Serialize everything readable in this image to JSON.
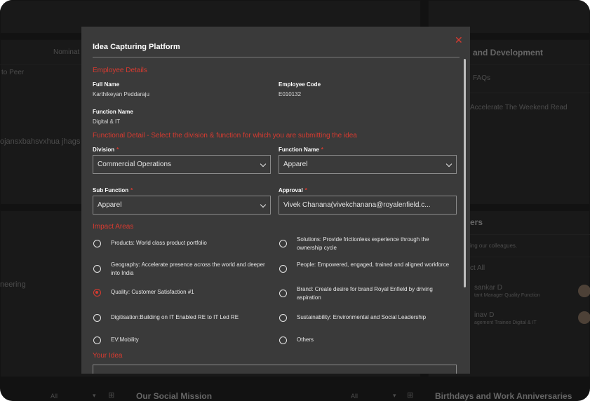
{
  "background": {
    "nominations_label": "Nominat",
    "peer_label": "to Peer",
    "user_fragment": "ojansxbahsvxhua jhags",
    "engineering_fragment": "neering",
    "filter_all_1": "All",
    "filter_all_2": "All",
    "social_mission": "Our Social Mission",
    "learning_heading": "and Development",
    "faqs": "FAQs",
    "weekend_read": "Accelerate The Weekend Read",
    "joiners_heading": "ers",
    "colleagues_text": "ing our colleagues.",
    "view_all": "ct All",
    "person1_name": "sankar D",
    "person1_role": "tant Manager Quality Function",
    "person2_name": "inav D",
    "person2_role": "agement Trainee Digital & IT",
    "birthdays": "Birthdays and Work Anniversaries"
  },
  "modal": {
    "title": "Idea Capturing Platform",
    "close_icon": "close-icon",
    "employee_section": "Employee Details",
    "full_name_label": "Full Name",
    "full_name_value": "Karthikeyan Peddaraju",
    "employee_code_label": "Employee Code",
    "employee_code_value": "E010132",
    "function_name_label": "Function Name",
    "function_name_value": "Digital & IT",
    "functional_section": "Functional Detail - Select the division & function for which you are submitting the idea",
    "division_label": "Division",
    "division_value": "Commercial Operations",
    "function_label": "Function Name",
    "function_value": "Apparel",
    "sub_function_label": "Sub Function",
    "sub_function_value": "Apparel",
    "approval_label": "Approval",
    "approval_value": "Vivek Chanana(vivekchanana@royalenfield.c...",
    "required_mark": "*",
    "impact_section": "Impact Areas",
    "impact_options": [
      {
        "text": "Products: World class product portfolio",
        "selected": false
      },
      {
        "text": "Solutions: Provide frictionless experience through the ownership cycle",
        "selected": false
      },
      {
        "text": "Geography: Accelerate presence across the world and deeper into India",
        "selected": false
      },
      {
        "text": "People: Empowered, engaged, trained and aligned workforce",
        "selected": false
      },
      {
        "text": "Quality: Customer Satisfaction #1",
        "selected": true
      },
      {
        "text": "Brand: Create desire for brand Royal Enfield by driving aspiration",
        "selected": false
      },
      {
        "text": "Digitisation:Building on IT Enabled RE to IT Led RE",
        "selected": false
      },
      {
        "text": "Sustainability: Environmental and Social Leadership",
        "selected": false
      },
      {
        "text": "EV:Mobility",
        "selected": false
      },
      {
        "text": "Others",
        "selected": false
      }
    ],
    "idea_section": "Your Idea",
    "accent_color": "#d83a30"
  }
}
